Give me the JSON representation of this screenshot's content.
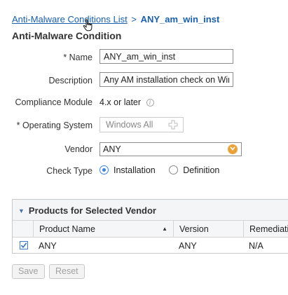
{
  "breadcrumb": {
    "link": "Anti-Malware Conditions List",
    "separator": ">",
    "current": "ANY_am_win_inst"
  },
  "title": "Anti-Malware Condition",
  "form": {
    "name_label": "* Name",
    "name_value": "ANY_am_win_inst",
    "description_label": "Description",
    "description_value": "Any AM installation check on Winc",
    "compliance_label": "Compliance Module",
    "compliance_value": "4.x or later",
    "os_label": "* Operating System",
    "os_value": "Windows All",
    "vendor_label": "Vendor",
    "vendor_value": "ANY",
    "check_type_label": "Check Type",
    "check_type_options": [
      "Installation",
      "Definition"
    ],
    "check_type_selected": "Installation"
  },
  "products": {
    "title": "Products for Selected Vendor",
    "columns": [
      "Product Name",
      "Version",
      "Remediatio"
    ],
    "rows": [
      {
        "checked": true,
        "product_name": "ANY",
        "version": "ANY",
        "remediation": "N/A"
      }
    ]
  },
  "buttons": {
    "save": "Save",
    "reset": "Reset"
  },
  "colors": {
    "link": "#1a5fa8",
    "accent_orange": "#e8a33c",
    "radio_blue": "#3b86d8"
  },
  "icons": [
    "hand-pointer-icon",
    "info-icon",
    "plus-icon",
    "chevron-down-icon",
    "collapse-triangle-icon",
    "sort-ascending-icon",
    "checkmark-icon"
  ]
}
